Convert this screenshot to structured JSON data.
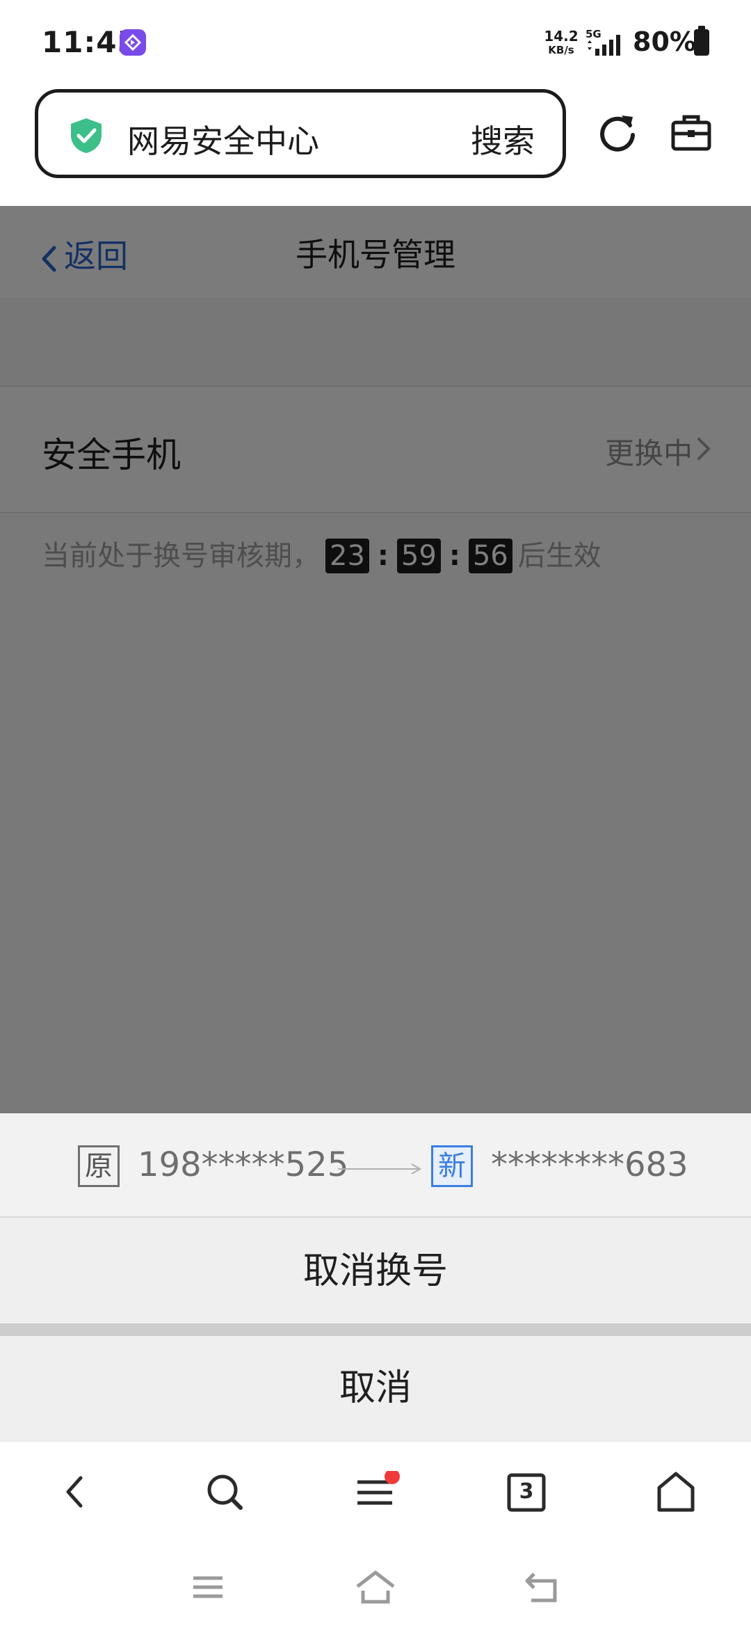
{
  "status_bar": {
    "time": "11:45",
    "net_speed_value": "14.2",
    "net_speed_unit": "KB/s",
    "network": "5G",
    "battery": "80%"
  },
  "address_bar": {
    "text": "网易安全中心",
    "search_label": "搜索"
  },
  "page": {
    "back_label": "返回",
    "title": "手机号管理",
    "row": {
      "label": "安全手机",
      "status": "更换中"
    },
    "notice": {
      "prefix": "当前处于换号审核期，",
      "hours": "23",
      "minutes": "59",
      "seconds": "56",
      "suffix": "后生效"
    }
  },
  "sheet": {
    "old_tag": "原",
    "old_number": "198*****525",
    "new_tag": "新",
    "new_number": "********683",
    "cancel_change_label": "取消换号",
    "cancel_label": "取消"
  },
  "browser_toolbar": {
    "tabs_count": "3"
  },
  "colors": {
    "accent_blue": "#2a63c9",
    "shield_green": "#3dbf8a",
    "badge_red": "#f03a3a"
  }
}
